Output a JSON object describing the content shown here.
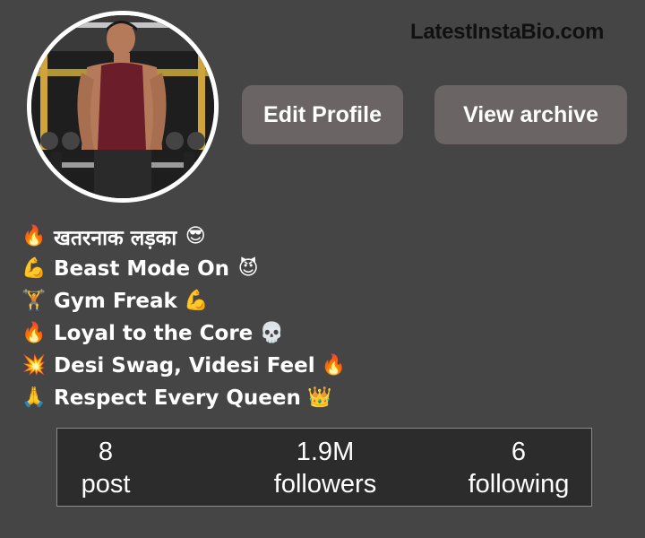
{
  "site": {
    "watermark": "LatestInstaBio.com"
  },
  "profile": {
    "avatar_icon": "gym-man-photo",
    "buttons": {
      "edit": "Edit Profile",
      "archive": "View archive"
    }
  },
  "bio": [
    {
      "pre": "🔥",
      "text": "खतरनाक लड़का",
      "post": "😎"
    },
    {
      "pre": "💪",
      "text": "Beast Mode On",
      "post": "😈"
    },
    {
      "pre": "🏋",
      "text": "Gym Freak",
      "post": "💪"
    },
    {
      "pre": "🔥",
      "text": "Loyal to the Core",
      "post": "💀"
    },
    {
      "pre": "💥",
      "text": "Desi Swag, Videsi Feel",
      "post": "🔥"
    },
    {
      "pre": "🙏",
      "text": "Respect Every Queen",
      "post": "👑"
    }
  ],
  "stats": {
    "posts": {
      "value": "8",
      "label": "post"
    },
    "followers": {
      "value": "1.9M",
      "label": "followers"
    },
    "following": {
      "value": "6",
      "label": "following"
    }
  }
}
